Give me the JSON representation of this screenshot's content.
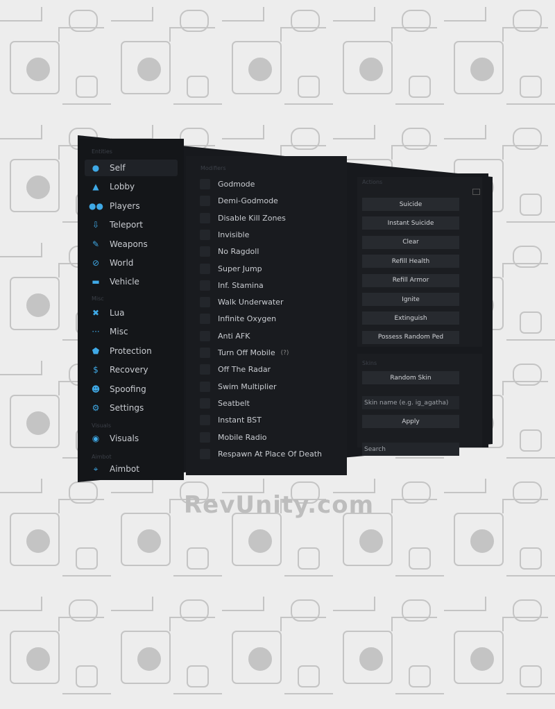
{
  "colors": {
    "accent": "#3fa9e6",
    "panel": "#17191d",
    "background": "#ededed"
  },
  "sidebar": {
    "sections": [
      {
        "header": "Entities",
        "items": [
          {
            "label": "Self",
            "icon": "user-icon",
            "active": true
          },
          {
            "label": "Lobby",
            "icon": "incognito-icon"
          },
          {
            "label": "Players",
            "icon": "users-icon"
          },
          {
            "label": "Teleport",
            "icon": "teleport-icon"
          },
          {
            "label": "Weapons",
            "icon": "weapon-icon"
          },
          {
            "label": "World",
            "icon": "globe-icon"
          },
          {
            "label": "Vehicle",
            "icon": "car-icon"
          }
        ]
      },
      {
        "header": "Misc",
        "items": [
          {
            "label": "Lua",
            "icon": "tools-icon"
          },
          {
            "label": "Misc",
            "icon": "dots-icon"
          },
          {
            "label": "Protection",
            "icon": "shield-icon"
          },
          {
            "label": "Recovery",
            "icon": "dollar-icon"
          },
          {
            "label": "Spoofing",
            "icon": "mask-icon"
          },
          {
            "label": "Settings",
            "icon": "gear-icon"
          }
        ]
      },
      {
        "header": "Visuals",
        "items": [
          {
            "label": "Visuals",
            "icon": "eye-icon"
          }
        ]
      },
      {
        "header": "Aimbot",
        "items": [
          {
            "label": "Aimbot",
            "icon": "crosshair-icon"
          }
        ]
      }
    ]
  },
  "modifiers": {
    "header": "Modifiers",
    "items": [
      "Godmode",
      "Demi-Godmode",
      "Disable Kill Zones",
      "Invisible",
      "No Ragdoll",
      "Super Jump",
      "Inf. Stamina",
      "Walk Underwater",
      "Infinite Oxygen",
      "Anti AFK",
      "Turn Off Mobile",
      "Off The Radar",
      "Swim Multiplier",
      "Seatbelt",
      "Instant BST",
      "Mobile Radio",
      "Respawn At Place Of Death"
    ],
    "help_marker": "(?)"
  },
  "actions": {
    "header": "Actions",
    "buttons": [
      "Suicide",
      "Instant Suicide",
      "Clear",
      "Refill Health",
      "Refill Armor",
      "Ignite",
      "Extinguish",
      "Possess Random Ped"
    ]
  },
  "skins": {
    "header": "Skins",
    "random_label": "Random Skin",
    "skin_placeholder": "Skin name (e.g. ig_agatha)",
    "apply_label": "Apply",
    "search_placeholder": "Search"
  },
  "watermark": "RevUnity.com"
}
